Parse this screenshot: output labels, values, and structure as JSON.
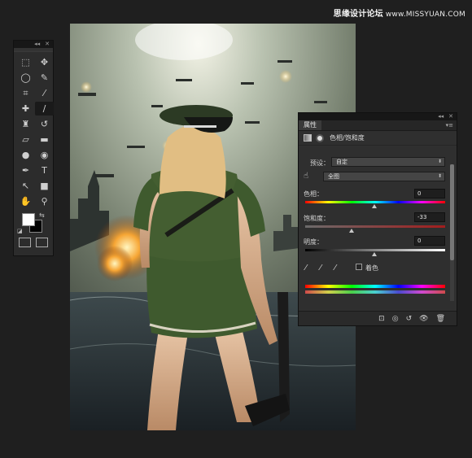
{
  "watermark": {
    "brand": "思缘设计论坛",
    "site": "www.MISSYUAN.COM"
  },
  "toolbar": {
    "header_glyphs": [
      "◂◂",
      "✕"
    ],
    "tools": [
      {
        "name": "marquee-tool-icon",
        "glyph": "⬚"
      },
      {
        "name": "move-tool-icon",
        "glyph": "✥"
      },
      {
        "name": "lasso-tool-icon",
        "glyph": "◯"
      },
      {
        "name": "quick-select-tool-icon",
        "glyph": "✎"
      },
      {
        "name": "crop-tool-icon",
        "glyph": "⌗"
      },
      {
        "name": "eyedropper-tool-icon",
        "glyph": "⁄"
      },
      {
        "name": "healing-brush-tool-icon",
        "glyph": "✚"
      },
      {
        "name": "brush-tool-icon",
        "glyph": "∕"
      },
      {
        "name": "clone-stamp-tool-icon",
        "glyph": "♜"
      },
      {
        "name": "history-brush-tool-icon",
        "glyph": "↺"
      },
      {
        "name": "eraser-tool-icon",
        "glyph": "▱"
      },
      {
        "name": "gradient-tool-icon",
        "glyph": "▬"
      },
      {
        "name": "blur-tool-icon",
        "glyph": "●"
      },
      {
        "name": "dodge-tool-icon",
        "glyph": "◉"
      },
      {
        "name": "pen-tool-icon",
        "glyph": "✒"
      },
      {
        "name": "type-tool-icon",
        "glyph": "T"
      },
      {
        "name": "path-select-tool-icon",
        "glyph": "↖"
      },
      {
        "name": "shape-tool-icon",
        "glyph": "■"
      },
      {
        "name": "hand-tool-icon",
        "glyph": "✋"
      },
      {
        "name": "zoom-tool-icon",
        "glyph": "⚲"
      }
    ],
    "foreground_color": "#ffffff",
    "background_color": "#000000",
    "swap_glyph": "⇆",
    "default_glyph": "◪"
  },
  "panel": {
    "header_glyphs": [
      "◂◂",
      "✕"
    ],
    "tab_label": "属性",
    "menu_glyph": "▾≡",
    "title": "色相/饱和度",
    "preset_label": "预设：",
    "preset_value": "自定",
    "channel_value": "全图",
    "hue": {
      "label": "色相：",
      "value": "0"
    },
    "saturation": {
      "label": "饱和度：",
      "value": "-33"
    },
    "lightness": {
      "label": "明度：",
      "value": "0"
    },
    "colorize_label": "着色",
    "footer_glyphs": [
      "⊡",
      "◎",
      "↺",
      "👁",
      "🗑"
    ]
  },
  "colors": {
    "panel_bg": "#2f2f2f",
    "app_bg": "#1f1f1f",
    "uniform_green": "#3f5a2e"
  }
}
